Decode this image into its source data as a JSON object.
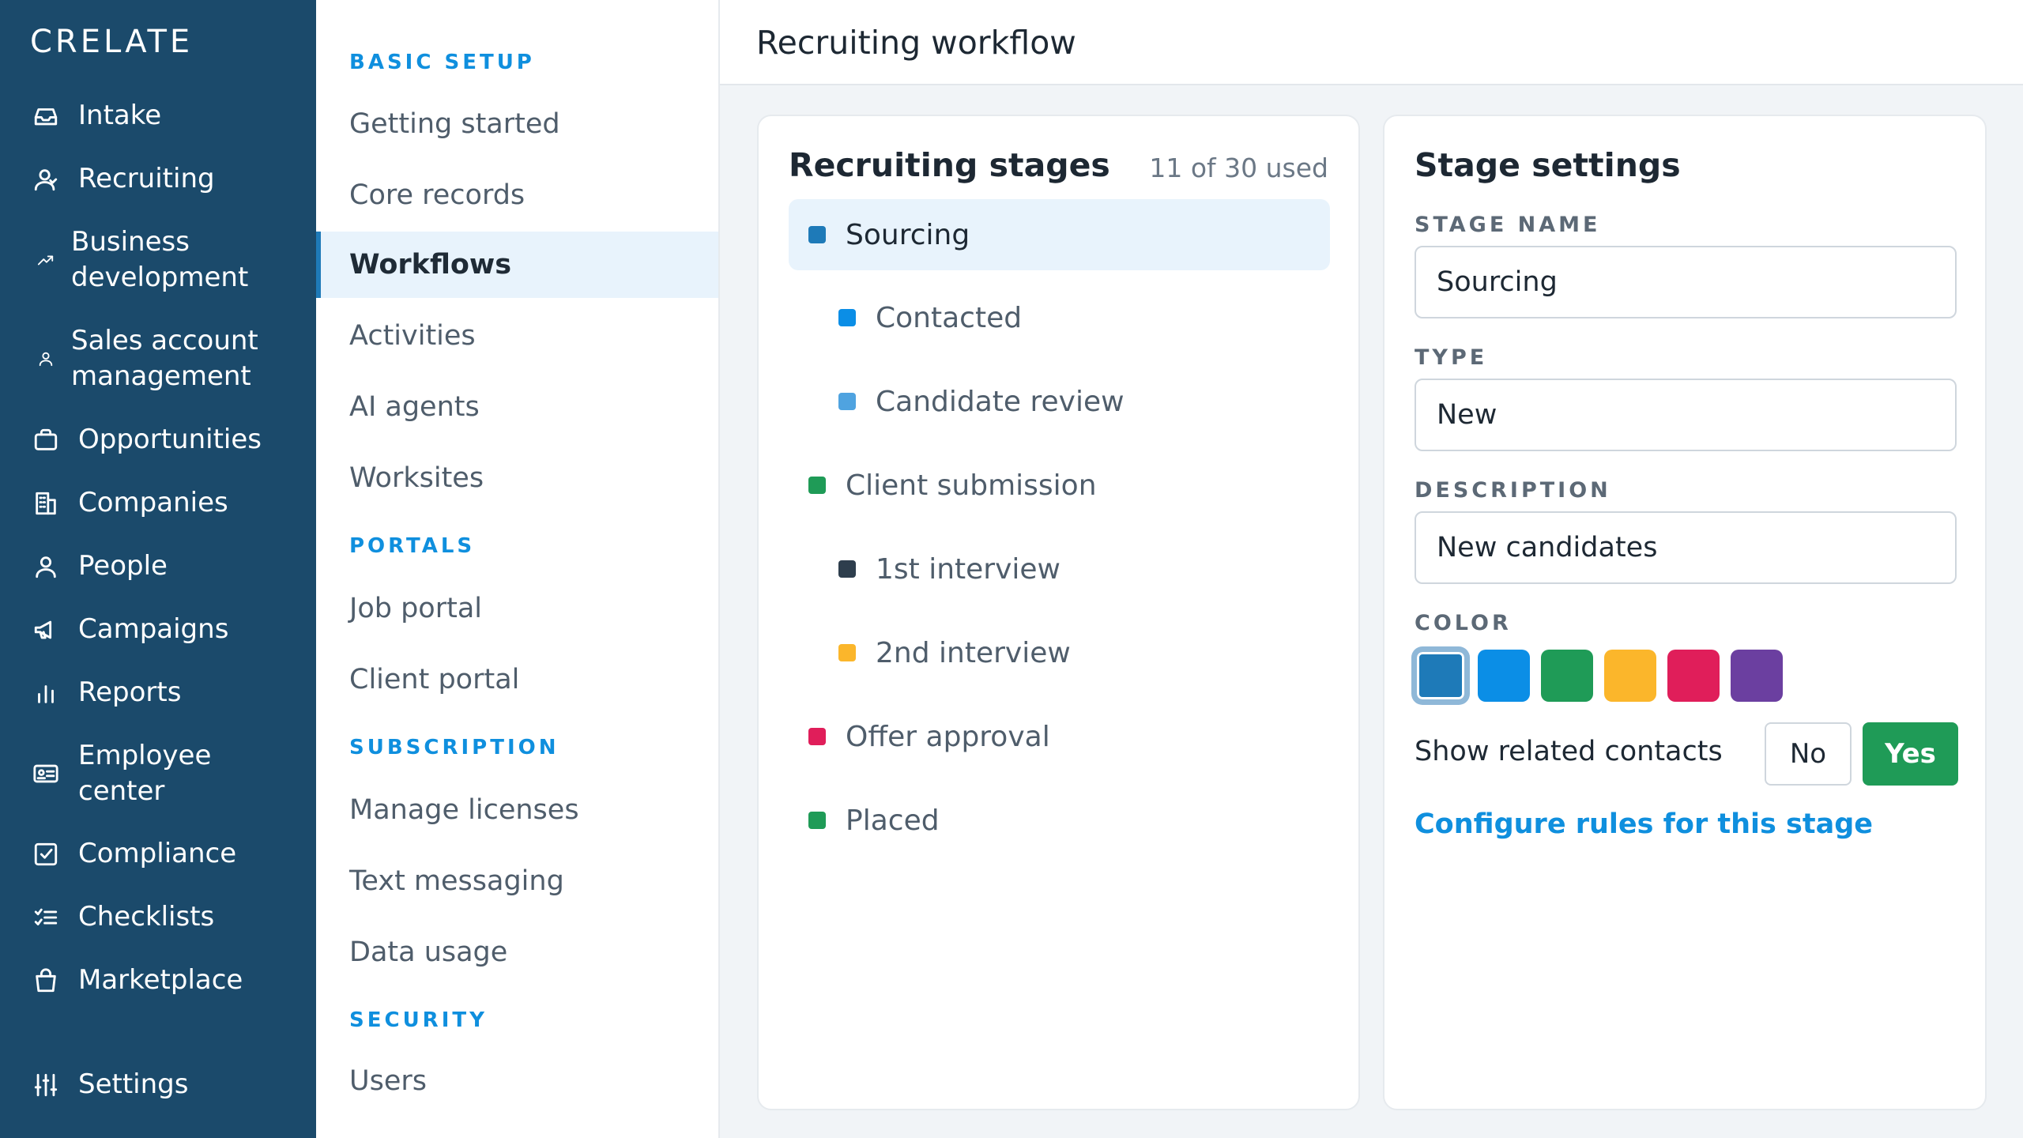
{
  "app": {
    "brand": "CRELATE",
    "nav": [
      {
        "label": "Intake",
        "icon": "inbox-icon"
      },
      {
        "label": "Recruiting",
        "icon": "user-icon"
      },
      {
        "label": "Business\ndevelopment",
        "icon": "trend-up-icon"
      },
      {
        "label": "Sales account\nmanagement",
        "icon": "user-small-icon"
      },
      {
        "label": "Opportunities",
        "icon": "briefcase-icon"
      },
      {
        "label": "Companies",
        "icon": "building-icon"
      },
      {
        "label": "People",
        "icon": "person-icon"
      },
      {
        "label": "Campaigns",
        "icon": "megaphone-icon"
      },
      {
        "label": "Reports",
        "icon": "bar-chart-icon"
      },
      {
        "label": "Employee\ncenter",
        "icon": "id-card-icon"
      },
      {
        "label": "Compliance",
        "icon": "checkbox-icon"
      },
      {
        "label": "Checklists",
        "icon": "checklist-icon"
      },
      {
        "label": "Marketplace",
        "icon": "shopping-bag-icon"
      }
    ],
    "settings_label": "Settings"
  },
  "settings_nav": {
    "sections": {
      "basic_setup": "BASIC SETUP",
      "portals": "PORTALS",
      "subscription": "SUBSCRIPTION",
      "security": "SECURITY"
    },
    "items": {
      "getting_started": "Getting started",
      "core_records": "Core records",
      "workflows": "Workflows",
      "activities": "Activities",
      "ai_agents": "AI agents",
      "worksites": "Worksites",
      "job_portal": "Job portal",
      "client_portal": "Client portal",
      "manage_licenses": "Manage licenses",
      "text_messaging": "Text messaging",
      "data_usage": "Data usage",
      "users": "Users"
    },
    "active": "Workflows"
  },
  "header": {
    "title": "Recruiting workflow"
  },
  "stages_panel": {
    "title": "Recruiting stages",
    "usage": "11 of 30 used",
    "stages": [
      {
        "name": "Sourcing",
        "color": "#1e7ab8",
        "level": 0,
        "selected": true
      },
      {
        "name": "Contacted",
        "color": "#0b8ee6",
        "level": 1
      },
      {
        "name": "Candidate review",
        "color": "#4fa3e0",
        "level": 1
      },
      {
        "name": "Client submission",
        "color": "#1f9b57",
        "level": 0
      },
      {
        "name": "1st interview",
        "color": "#2e3e4d",
        "level": 1
      },
      {
        "name": "2nd interview",
        "color": "#fbb62b",
        "level": 1
      },
      {
        "name": "Offer approval",
        "color": "#e01e5a",
        "level": 0
      },
      {
        "name": "Placed",
        "color": "#1f9b57",
        "level": 0
      }
    ]
  },
  "stage_settings": {
    "title": "Stage settings",
    "stage_name_label": "STAGE NAME",
    "stage_name_value": "Sourcing",
    "type_label": "TYPE",
    "type_value": "New",
    "description_label": "DESCRIPTION",
    "description_value": "New candidates",
    "color_label": "COLOR",
    "colors": [
      "#1e7ab8",
      "#0b8ee6",
      "#1f9b57",
      "#fbb62b",
      "#e01e5a",
      "#6b3fa0"
    ],
    "selected_color_index": 0,
    "show_related_label": "Show related contacts",
    "no_label": "No",
    "yes_label": "Yes",
    "configure_link": "Configure rules for this stage"
  }
}
